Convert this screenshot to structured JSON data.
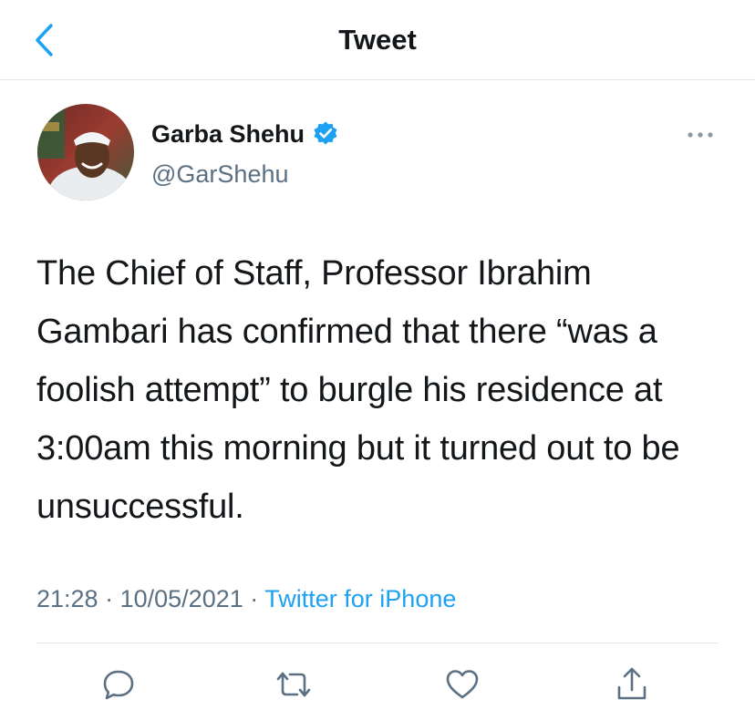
{
  "header": {
    "title": "Tweet",
    "back_icon": "chevron-left-icon"
  },
  "colors": {
    "accent": "#1da1f2",
    "text": "#14171a",
    "secondary": "#5b7083",
    "divider": "#e1e8ed"
  },
  "tweet": {
    "author_name": "Garba Shehu",
    "author_handle": "@GarShehu",
    "verified": true,
    "text": "The Chief of Staff, Professor Ibrahim Gambari has confirmed that there “was a foolish attempt” to burgle his residence at 3:00am this morning but it turned out to be unsuccessful.",
    "time": "21:28",
    "date": "10/05/2021",
    "separator": "·",
    "source": "Twitter for iPhone"
  },
  "actions": [
    {
      "name": "reply",
      "icon": "reply-icon"
    },
    {
      "name": "retweet",
      "icon": "retweet-icon"
    },
    {
      "name": "like",
      "icon": "heart-icon"
    },
    {
      "name": "share",
      "icon": "share-icon"
    }
  ]
}
